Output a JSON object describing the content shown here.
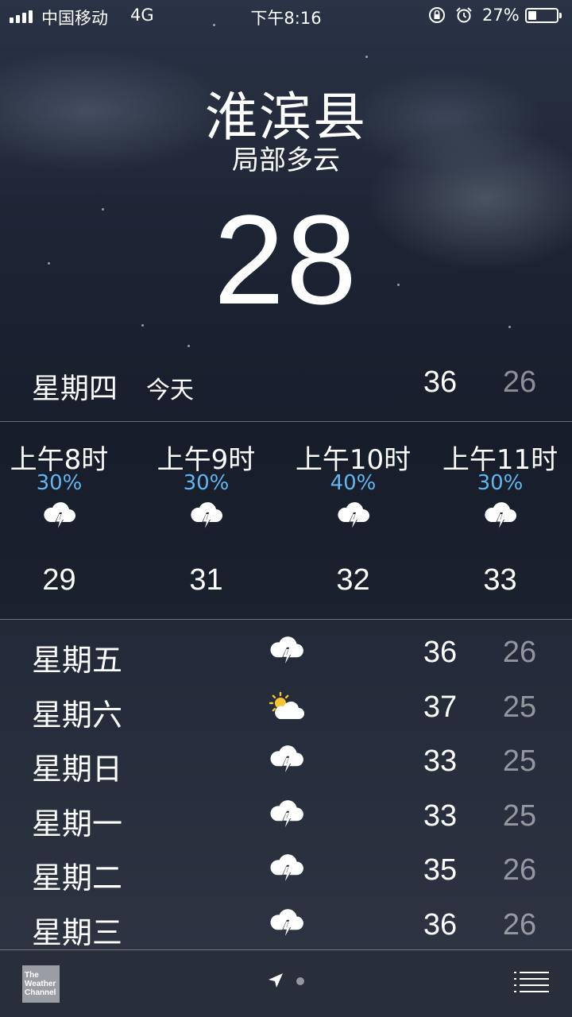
{
  "status_bar": {
    "carrier": "中国移动",
    "network": "4G",
    "time": "下午8:16",
    "battery_percent": "27%",
    "battery_level": 0.27,
    "icons": [
      "signal-icon",
      "orientation-lock-icon",
      "alarm-icon",
      "battery-icon"
    ]
  },
  "location": {
    "city": "淮滨县",
    "condition": "局部多云",
    "temperature": "28"
  },
  "today": {
    "day": "星期四",
    "label": "今天",
    "high": "36",
    "low": "26"
  },
  "hourly": [
    {
      "time": "上午8时",
      "precip": "30%",
      "icon": "thunderstorm-icon",
      "temp": "29"
    },
    {
      "time": "上午9时",
      "precip": "30%",
      "icon": "thunderstorm-icon",
      "temp": "31"
    },
    {
      "time": "上午10时",
      "precip": "40%",
      "icon": "thunderstorm-icon",
      "temp": "32"
    },
    {
      "time": "上午11时",
      "precip": "30%",
      "icon": "thunderstorm-icon",
      "temp": "33"
    }
  ],
  "daily": [
    {
      "day": "星期五",
      "icon": "thunderstorm-icon",
      "high": "36",
      "low": "26"
    },
    {
      "day": "星期六",
      "icon": "partly-sunny-icon",
      "high": "37",
      "low": "25"
    },
    {
      "day": "星期日",
      "icon": "thunderstorm-icon",
      "high": "33",
      "low": "25"
    },
    {
      "day": "星期一",
      "icon": "thunderstorm-icon",
      "high": "33",
      "low": "25"
    },
    {
      "day": "星期二",
      "icon": "thunderstorm-icon",
      "high": "35",
      "low": "26"
    },
    {
      "day": "星期三",
      "icon": "thunderstorm-icon",
      "high": "36",
      "low": "26"
    }
  ],
  "bottom_bar": {
    "provider_logo": "The Weather Channel",
    "icons": [
      "location-arrow-icon",
      "page-dot",
      "list-icon"
    ]
  },
  "colors": {
    "precip_blue": "#63b5f0",
    "low_temp": "rgba(255,255,255,0.5)",
    "sky_dark": "#1b2233"
  }
}
